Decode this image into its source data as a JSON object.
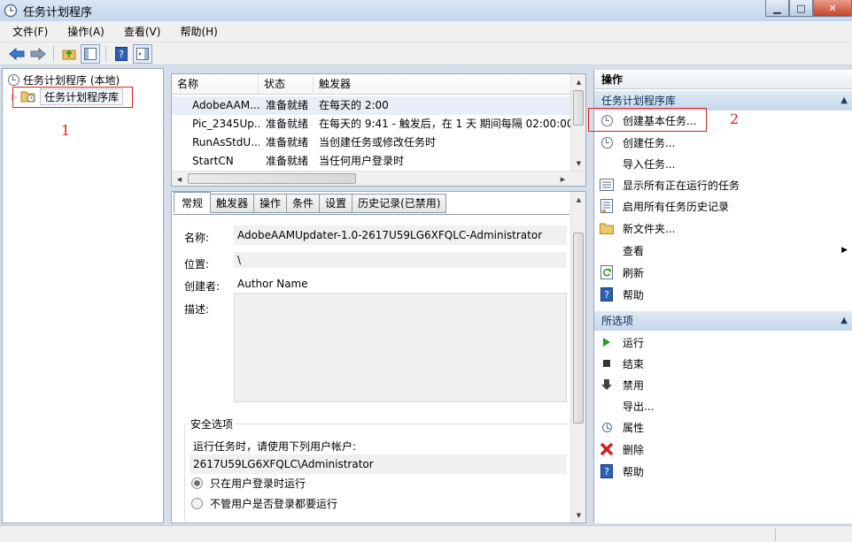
{
  "window": {
    "title": "任务计划程序"
  },
  "menu": [
    "文件(F)",
    "操作(A)",
    "查看(V)",
    "帮助(H)"
  ],
  "tree": {
    "root_label": "任务计划程序 (本地)",
    "child_label": "任务计划程序库",
    "annotation": "1"
  },
  "task_list": {
    "headers": [
      "名称",
      "状态",
      "触发器"
    ],
    "rows": [
      {
        "name": "AdobeAAM...",
        "status": "准备就绪",
        "trigger": "在每天的 2:00"
      },
      {
        "name": "Pic_2345Up...",
        "status": "准备就绪",
        "trigger": "在每天的 9:41 - 触发后，在 1 天 期间每隔 02:00:00"
      },
      {
        "name": "RunAsStdU...",
        "status": "准备就绪",
        "trigger": "当创建任务或修改任务时"
      },
      {
        "name": "StartCN",
        "status": "准备就绪",
        "trigger": "当任何用户登录时"
      }
    ]
  },
  "detail": {
    "tabs": [
      "常规",
      "触发器",
      "操作",
      "条件",
      "设置",
      "历史记录(已禁用)"
    ],
    "name_label": "名称:",
    "name_value": "AdobeAAMUpdater-1.0-2617U59LG6XFQLC-Administrator",
    "location_label": "位置:",
    "location_value": "\\",
    "author_label": "创建者:",
    "author_value": "Author Name",
    "desc_label": "描述:",
    "security_title": "安全选项",
    "run_as_text": "运行任务时，请使用下列用户帐户:",
    "account_value": "2617U59LG6XFQLC\\Administrator",
    "option_logged_on": "只在用户登录时运行",
    "option_not_logged_on": "不管用户是否登录都要运行"
  },
  "actions": {
    "title": "操作",
    "section1_title": "任务计划程序库",
    "section1_items": [
      {
        "label": "创建基本任务...",
        "icon": "create-basic-task-icon"
      },
      {
        "label": "创建任务...",
        "icon": "create-task-icon"
      },
      {
        "label": "导入任务...",
        "icon": "import-task-icon"
      },
      {
        "label": "显示所有正在运行的任务",
        "icon": "running-tasks-icon"
      },
      {
        "label": "启用所有任务历史记录",
        "icon": "history-icon"
      },
      {
        "label": "新文件夹...",
        "icon": "folder-icon"
      },
      {
        "label": "查看",
        "icon": "none"
      },
      {
        "label": "刷新",
        "icon": "refresh-icon"
      },
      {
        "label": "帮助",
        "icon": "help-icon"
      }
    ],
    "annotation": "2",
    "section2_title": "所选项",
    "section2_items": [
      {
        "label": "运行",
        "icon": "run-icon"
      },
      {
        "label": "结束",
        "icon": "stop-icon"
      },
      {
        "label": "禁用",
        "icon": "disable-icon"
      },
      {
        "label": "导出...",
        "icon": "none"
      },
      {
        "label": "属性",
        "icon": "properties-icon"
      },
      {
        "label": "删除",
        "icon": "delete-icon"
      },
      {
        "label": "帮助",
        "icon": "help-icon"
      }
    ]
  },
  "colors": {
    "annotation_red": "#e02020",
    "section_blue": "#c6d7ec"
  }
}
